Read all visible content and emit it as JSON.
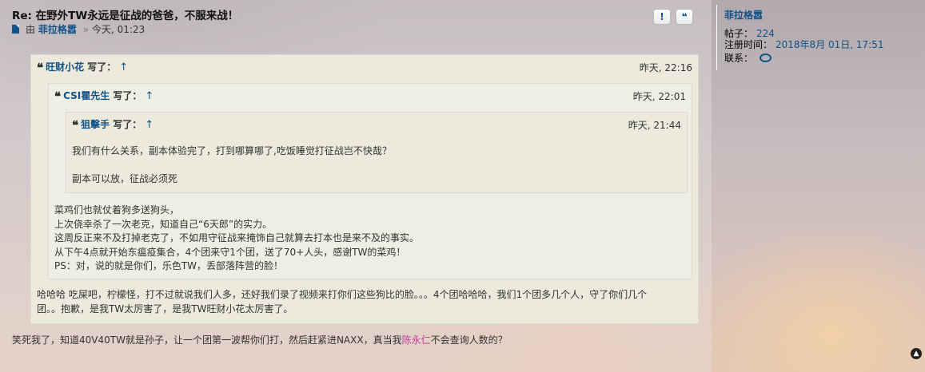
{
  "post": {
    "title": "Re: 在野外TW永远是征战的爸爸，不服来战！",
    "by": "由",
    "author": "菲拉格嚣",
    "separator": "»",
    "time": "今天, 01:23",
    "buttons": {
      "report": "!",
      "quote": "❝"
    }
  },
  "quotes": {
    "outer": {
      "author": "旺财小花",
      "wrote": "写了：",
      "time": "昨天, 22:16",
      "after_lines": [
        "哈哈哈 吃屎吧，柠檬怪，打不过就说我们人多，还好我们录了视频来打你们这些狗比的脸。。。4个团哈哈哈，我们1个团多几个人，守了你们几个",
        "团。。抱歉，是我TW太厉害了，是我TW旺财小花太厉害了。"
      ]
    },
    "middle": {
      "author": "CSI瞿先生",
      "wrote": "写了：",
      "time": "昨天, 22:01",
      "after_lines": [
        "菜鸡们也就仗着狗多送狗头，",
        "上次侥幸杀了一次老克，知道自己“6天郎”的实力。",
        "这周反正来不及打掉老克了，不如用守征战来掩饰自己就算去打本也是来不及的事实。",
        "从下午4点就开始东瘟疫集合，4个团来守1个团，送了70+人头，感谢TW的菜鸡！",
        "PS：对，说的就是你们，乐色TW，丢部落阵营的脸！"
      ]
    },
    "inner": {
      "author": "狙擊手",
      "wrote": "写了：",
      "time": "昨天, 21:44",
      "lines": [
        "我们有什么关系，副本体验完了，打到哪算哪了,吃饭睡觉打征战岂不快哉？",
        "副本可以放，征战必须死"
      ]
    },
    "uparrow": "↑"
  },
  "reply": {
    "before": "笑死我了，知道40V40TW就是孙子，让一个团第一波帮你们打，然后赶紧进NAXX，真当我",
    "highlight": "陈永仁",
    "after": "不会查询人数的？"
  },
  "profile": {
    "name": "菲拉格嚣",
    "posts_label": "帖子：",
    "posts": "224",
    "joined_label": "注册时间：",
    "joined": "2018年8月 01日, 17:51",
    "contact_label": "联系："
  },
  "colors": {
    "link": "#105289",
    "highlight": "#c0409a",
    "quote_bg": "#ebeadd"
  },
  "icons": [
    "document-icon",
    "report-icon",
    "quote-icon",
    "chat-icon",
    "back-to-top-icon"
  ]
}
